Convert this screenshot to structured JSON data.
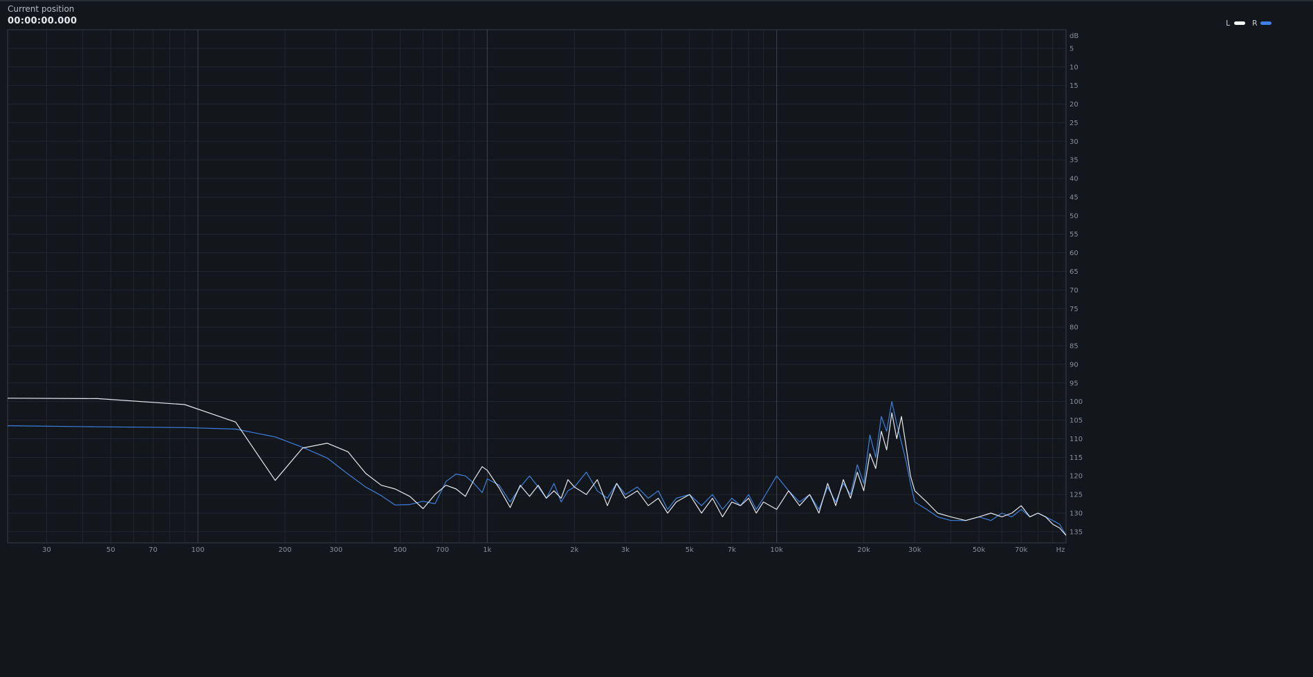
{
  "header": {
    "position_label": "Current position",
    "position_value": "00:00:00.000"
  },
  "legend": [
    {
      "label": "L",
      "color": "#ffffff"
    },
    {
      "label": "R",
      "color": "#3b82e6"
    }
  ],
  "chart_data": {
    "type": "line",
    "xscale": "log",
    "xlabel": "Hz",
    "ylabel": "dB",
    "xlim": [
      22,
      100000
    ],
    "ylim": [
      -138,
      0
    ],
    "grid": true,
    "legend_placement": "top-right",
    "x_ticks": [
      {
        "value": 30,
        "label": "30"
      },
      {
        "value": 50,
        "label": "50"
      },
      {
        "value": 70,
        "label": "70"
      },
      {
        "value": 100,
        "label": "100"
      },
      {
        "value": 200,
        "label": "200"
      },
      {
        "value": 300,
        "label": "300"
      },
      {
        "value": 500,
        "label": "500"
      },
      {
        "value": 700,
        "label": "700"
      },
      {
        "value": 1000,
        "label": "1k"
      },
      {
        "value": 2000,
        "label": "2k"
      },
      {
        "value": 3000,
        "label": "3k"
      },
      {
        "value": 5000,
        "label": "5k"
      },
      {
        "value": 7000,
        "label": "7k"
      },
      {
        "value": 10000,
        "label": "10k"
      },
      {
        "value": 20000,
        "label": "20k"
      },
      {
        "value": 30000,
        "label": "30k"
      },
      {
        "value": 50000,
        "label": "50k"
      },
      {
        "value": 70000,
        "label": "70k"
      }
    ],
    "y_ticks": [
      {
        "value": -5,
        "label": "5"
      },
      {
        "value": -10,
        "label": "10"
      },
      {
        "value": -15,
        "label": "15"
      },
      {
        "value": -20,
        "label": "20"
      },
      {
        "value": -25,
        "label": "25"
      },
      {
        "value": -30,
        "label": "30"
      },
      {
        "value": -35,
        "label": "35"
      },
      {
        "value": -40,
        "label": "40"
      },
      {
        "value": -45,
        "label": "45"
      },
      {
        "value": -50,
        "label": "50"
      },
      {
        "value": -55,
        "label": "55"
      },
      {
        "value": -60,
        "label": "60"
      },
      {
        "value": -65,
        "label": "65"
      },
      {
        "value": -70,
        "label": "70"
      },
      {
        "value": -75,
        "label": "75"
      },
      {
        "value": -80,
        "label": "80"
      },
      {
        "value": -85,
        "label": "85"
      },
      {
        "value": -90,
        "label": "90"
      },
      {
        "value": -95,
        "label": "95"
      },
      {
        "value": -100,
        "label": "100"
      },
      {
        "value": -105,
        "label": "105"
      },
      {
        "value": -110,
        "label": "110"
      },
      {
        "value": -115,
        "label": "115"
      },
      {
        "value": -120,
        "label": "120"
      },
      {
        "value": -125,
        "label": "125"
      },
      {
        "value": -130,
        "label": "130"
      },
      {
        "value": -135,
        "label": "135"
      }
    ],
    "series": [
      {
        "name": "L",
        "color": "#e8ebef",
        "x": [
          22,
          45,
          90,
          135,
          185,
          230,
          280,
          330,
          380,
          430,
          480,
          540,
          600,
          660,
          720,
          780,
          840,
          900,
          960,
          1000,
          1100,
          1200,
          1300,
          1400,
          1500,
          1600,
          1700,
          1800,
          1900,
          2000,
          2200,
          2400,
          2600,
          2800,
          3000,
          3300,
          3600,
          3900,
          4200,
          4500,
          5000,
          5500,
          6000,
          6500,
          7000,
          7500,
          8000,
          8500,
          9000,
          10000,
          11000,
          12000,
          13000,
          14000,
          15000,
          16000,
          17000,
          18000,
          19000,
          20000,
          21000,
          22000,
          23000,
          24000,
          25000,
          26000,
          27000,
          28000,
          29000,
          30000,
          33000,
          36000,
          40000,
          45000,
          50000,
          55000,
          60000,
          65000,
          70000,
          75000,
          80000,
          85000,
          90000,
          95000,
          100000
        ],
        "y": [
          -99.1,
          -99.2,
          -100.8,
          -105.5,
          -121.2,
          -112.5,
          -111.2,
          -113.5,
          -119.3,
          -122.5,
          -123.5,
          -125.5,
          -128.8,
          -125,
          -122.5,
          -123.5,
          -125.5,
          -121,
          -117.5,
          -118.5,
          -123.3,
          -128.5,
          -122.5,
          -125.5,
          -122.5,
          -126,
          -124,
          -126,
          -121,
          -123,
          -125,
          -121,
          -128,
          -122,
          -126,
          -124,
          -128,
          -126,
          -130,
          -127,
          -125,
          -130,
          -126,
          -131,
          -127,
          -128,
          -126,
          -130,
          -127,
          -129,
          -124,
          -128,
          -125,
          -130,
          -122,
          -128,
          -121,
          -126,
          -119,
          -124,
          -114,
          -118,
          -108,
          -113,
          -103,
          -110,
          -104,
          -112,
          -120,
          -124,
          -127,
          -130,
          -131,
          -132,
          -131,
          -130,
          -131,
          -130,
          -128,
          -131,
          -130,
          -131,
          -133,
          -134,
          -136
        ]
      },
      {
        "name": "R",
        "color": "#3b82e6",
        "x": [
          22,
          45,
          90,
          135,
          185,
          230,
          280,
          330,
          380,
          430,
          480,
          540,
          600,
          660,
          720,
          780,
          840,
          900,
          960,
          1000,
          1100,
          1200,
          1300,
          1400,
          1500,
          1600,
          1700,
          1800,
          1900,
          2000,
          2200,
          2400,
          2600,
          2800,
          3000,
          3300,
          3600,
          3900,
          4200,
          4500,
          5000,
          5500,
          6000,
          6500,
          7000,
          7500,
          8000,
          8500,
          9000,
          10000,
          11000,
          12000,
          13000,
          14000,
          15000,
          16000,
          17000,
          18000,
          19000,
          20000,
          21000,
          22000,
          23000,
          24000,
          25000,
          26000,
          27000,
          28000,
          29000,
          30000,
          33000,
          36000,
          40000,
          45000,
          50000,
          55000,
          60000,
          65000,
          70000,
          75000,
          80000,
          85000,
          90000,
          95000,
          100000
        ],
        "y": [
          -106.5,
          -106.8,
          -107,
          -107.4,
          -109.5,
          -112.3,
          -115.2,
          -119.5,
          -123,
          -125.3,
          -127.8,
          -127.7,
          -126.8,
          -127.5,
          -121.5,
          -119.5,
          -120,
          -122,
          -124.5,
          -120.8,
          -122.5,
          -127,
          -123,
          -120,
          -123,
          -126,
          -122,
          -127,
          -124,
          -123,
          -119,
          -124,
          -126,
          -122,
          -125,
          -123,
          -126,
          -124,
          -129,
          -126,
          -125,
          -128,
          -125,
          -129,
          -126,
          -128,
          -125,
          -129,
          -126,
          -120,
          -124,
          -127,
          -125,
          -129,
          -123,
          -127,
          -122,
          -125,
          -117,
          -122,
          -109,
          -115,
          -104,
          -108,
          -100,
          -106,
          -111,
          -116,
          -122,
          -127,
          -129,
          -131,
          -132,
          -132,
          -131,
          -132,
          -130,
          -131,
          -129,
          -131,
          -130,
          -131,
          -132,
          -133,
          -136
        ]
      }
    ]
  }
}
